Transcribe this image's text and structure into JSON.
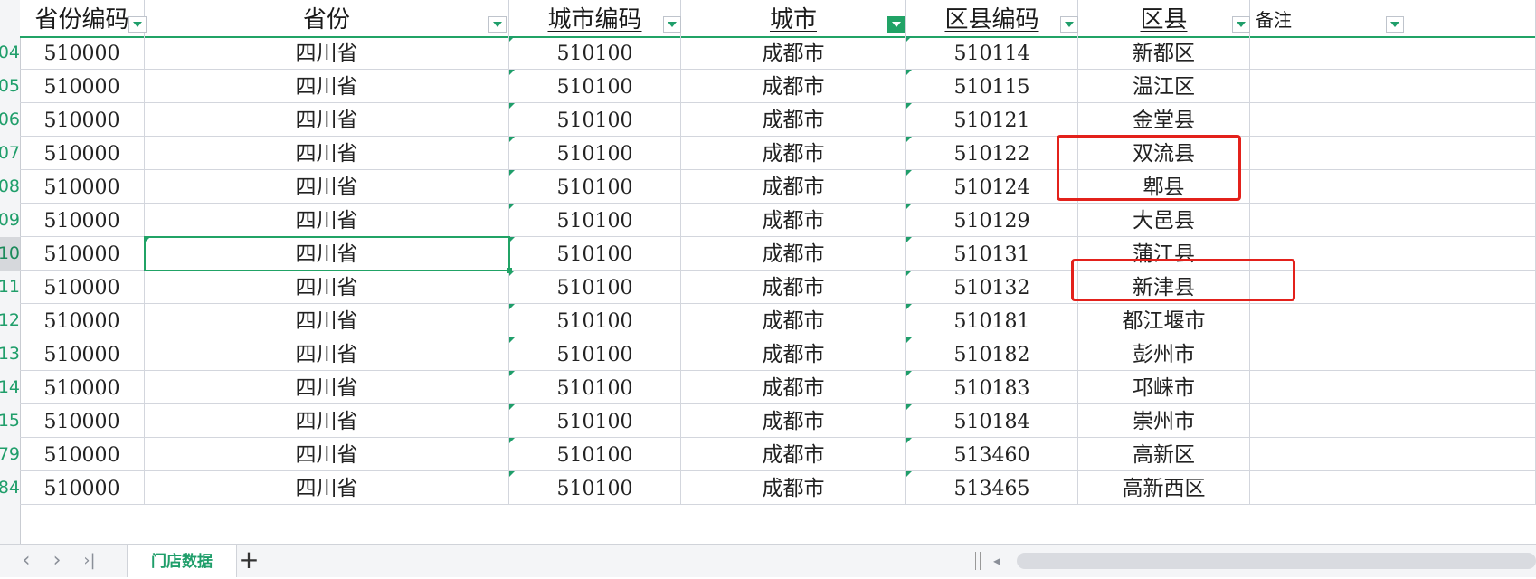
{
  "headers": [
    {
      "label": "省份编码",
      "underline": false
    },
    {
      "label": "省份",
      "underline": false
    },
    {
      "label": "城市编码",
      "underline": true
    },
    {
      "label": "城市",
      "underline": true
    },
    {
      "label": "区县编码",
      "underline": true
    },
    {
      "label": "区县",
      "underline": true
    },
    {
      "label": "备注",
      "underline": false
    }
  ],
  "row_numbers": [
    "04",
    "05",
    "06",
    "07",
    "08",
    "09",
    "10",
    "11",
    "12",
    "13",
    "14",
    "15",
    "79",
    "84"
  ],
  "active_row_index": 6,
  "rows": [
    [
      "510000",
      "四川省",
      "510100",
      "成都市",
      "510114",
      "新都区",
      ""
    ],
    [
      "510000",
      "四川省",
      "510100",
      "成都市",
      "510115",
      "温江区",
      ""
    ],
    [
      "510000",
      "四川省",
      "510100",
      "成都市",
      "510121",
      "金堂县",
      ""
    ],
    [
      "510000",
      "四川省",
      "510100",
      "成都市",
      "510122",
      "双流县",
      ""
    ],
    [
      "510000",
      "四川省",
      "510100",
      "成都市",
      "510124",
      "郫县",
      ""
    ],
    [
      "510000",
      "四川省",
      "510100",
      "成都市",
      "510129",
      "大邑县",
      ""
    ],
    [
      "510000",
      "四川省",
      "510100",
      "成都市",
      "510131",
      "蒲江县",
      ""
    ],
    [
      "510000",
      "四川省",
      "510100",
      "成都市",
      "510132",
      "新津县",
      ""
    ],
    [
      "510000",
      "四川省",
      "510100",
      "成都市",
      "510181",
      "都江堰市",
      ""
    ],
    [
      "510000",
      "四川省",
      "510100",
      "成都市",
      "510182",
      "彭州市",
      ""
    ],
    [
      "510000",
      "四川省",
      "510100",
      "成都市",
      "510183",
      "邛崃市",
      ""
    ],
    [
      "510000",
      "四川省",
      "510100",
      "成都市",
      "510184",
      "崇州市",
      ""
    ],
    [
      "510000",
      "四川省",
      "510100",
      "成都市",
      "513460",
      "高新区",
      ""
    ],
    [
      "510000",
      "四川省",
      "510100",
      "成都市",
      "513465",
      "高新西区",
      ""
    ]
  ],
  "selected_cell": {
    "row": 6,
    "col": 1
  },
  "active_filter_column": 3,
  "highlighted_district_rows": [
    [
      3,
      4
    ],
    [
      7
    ]
  ],
  "sheet_tab": {
    "label": "门店数据"
  },
  "add_sheet_symbol": "+",
  "nav": {
    "prev": "‹",
    "next": "›",
    "last": "›|"
  },
  "colors": {
    "accent": "#21a366",
    "highlight": "#e3211b",
    "filter_text": "#1f9e6a"
  }
}
